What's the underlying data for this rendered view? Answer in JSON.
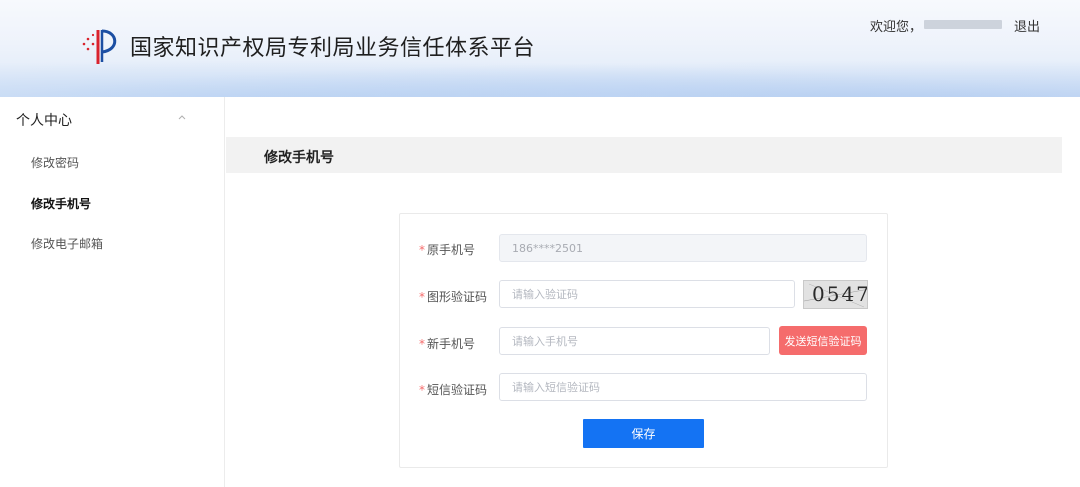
{
  "header": {
    "site_title": "国家知识产权局专利局业务信任体系平台",
    "welcome_text": "欢迎您，",
    "logout_label": "退出"
  },
  "sidebar": {
    "title": "个人中心",
    "items": [
      {
        "label": "修改密码",
        "active": false
      },
      {
        "label": "修改手机号",
        "active": true
      },
      {
        "label": "修改电子邮箱",
        "active": false
      }
    ]
  },
  "main": {
    "section_title": "修改手机号",
    "form": {
      "required_mark": "*",
      "original_phone": {
        "label": "原手机号",
        "value": "186****2501"
      },
      "image_captcha": {
        "label": "图形验证码",
        "placeholder": "请输入验证码",
        "captcha_text": "0547"
      },
      "new_phone": {
        "label": "新手机号",
        "placeholder": "请输入手机号",
        "send_button": "发送短信验证码"
      },
      "sms_code": {
        "label": "短信验证码",
        "placeholder": "请输入短信验证码"
      },
      "save_button": "保存"
    }
  },
  "colors": {
    "primary": "#1473f3",
    "danger": "#f56c6c",
    "logo_red": "#d9232d",
    "logo_blue": "#1c4fa3"
  }
}
